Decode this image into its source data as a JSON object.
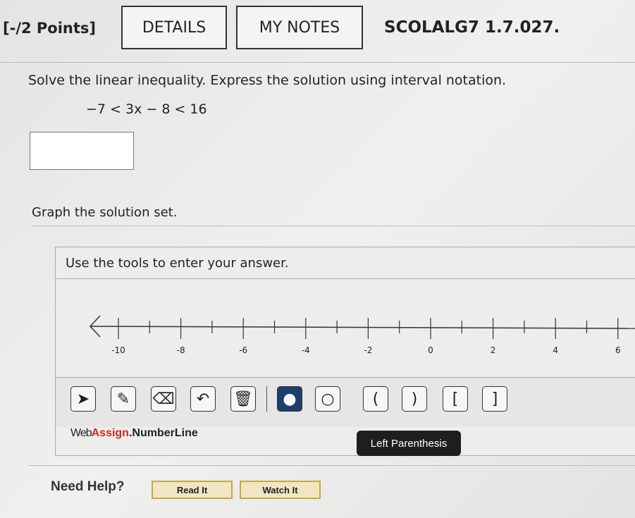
{
  "header": {
    "points": "[-/2 Points]",
    "details": "DETAILS",
    "my_notes": "MY NOTES",
    "problem_id": "SCOLALG7 1.7.027."
  },
  "question": {
    "prompt": "Solve the linear inequality. Express the solution using interval notation.",
    "inequality": "−7 < 3x − 8 < 16",
    "answer_value": "",
    "graph_prompt": "Graph the solution set."
  },
  "numberline": {
    "instructions": "Use the tools to enter your answer.",
    "min": -10,
    "max": 6,
    "labels": [
      "-10",
      "-8",
      "-6",
      "-4",
      "-2",
      "0",
      "2",
      "4",
      "6"
    ],
    "tools": [
      {
        "name": "pointer-icon",
        "glyph": "➤"
      },
      {
        "name": "pencil-icon",
        "glyph": "✎"
      },
      {
        "name": "eraser-icon",
        "glyph": "⌫"
      },
      {
        "name": "undo-icon",
        "glyph": "↶"
      },
      {
        "name": "trash-icon",
        "glyph": "🗑"
      },
      {
        "name": "closed-point-icon",
        "glyph": "●"
      },
      {
        "name": "open-point-icon",
        "glyph": "○"
      },
      {
        "name": "left-parenthesis-icon",
        "glyph": "("
      },
      {
        "name": "right-parenthesis-icon",
        "glyph": ")"
      },
      {
        "name": "left-bracket-icon",
        "glyph": "["
      },
      {
        "name": "right-bracket-icon",
        "glyph": "]"
      }
    ],
    "brand_web": "Web",
    "brand_assign": "Assign",
    "brand_suffix": ".NumberLine",
    "tooltip": "Left Parenthesis",
    "brand_color": "#d62828",
    "selected_tool_color": "#1d3f6e"
  },
  "help": {
    "label": "Need Help?",
    "read_it": "Read It",
    "watch_it": "Watch It"
  }
}
